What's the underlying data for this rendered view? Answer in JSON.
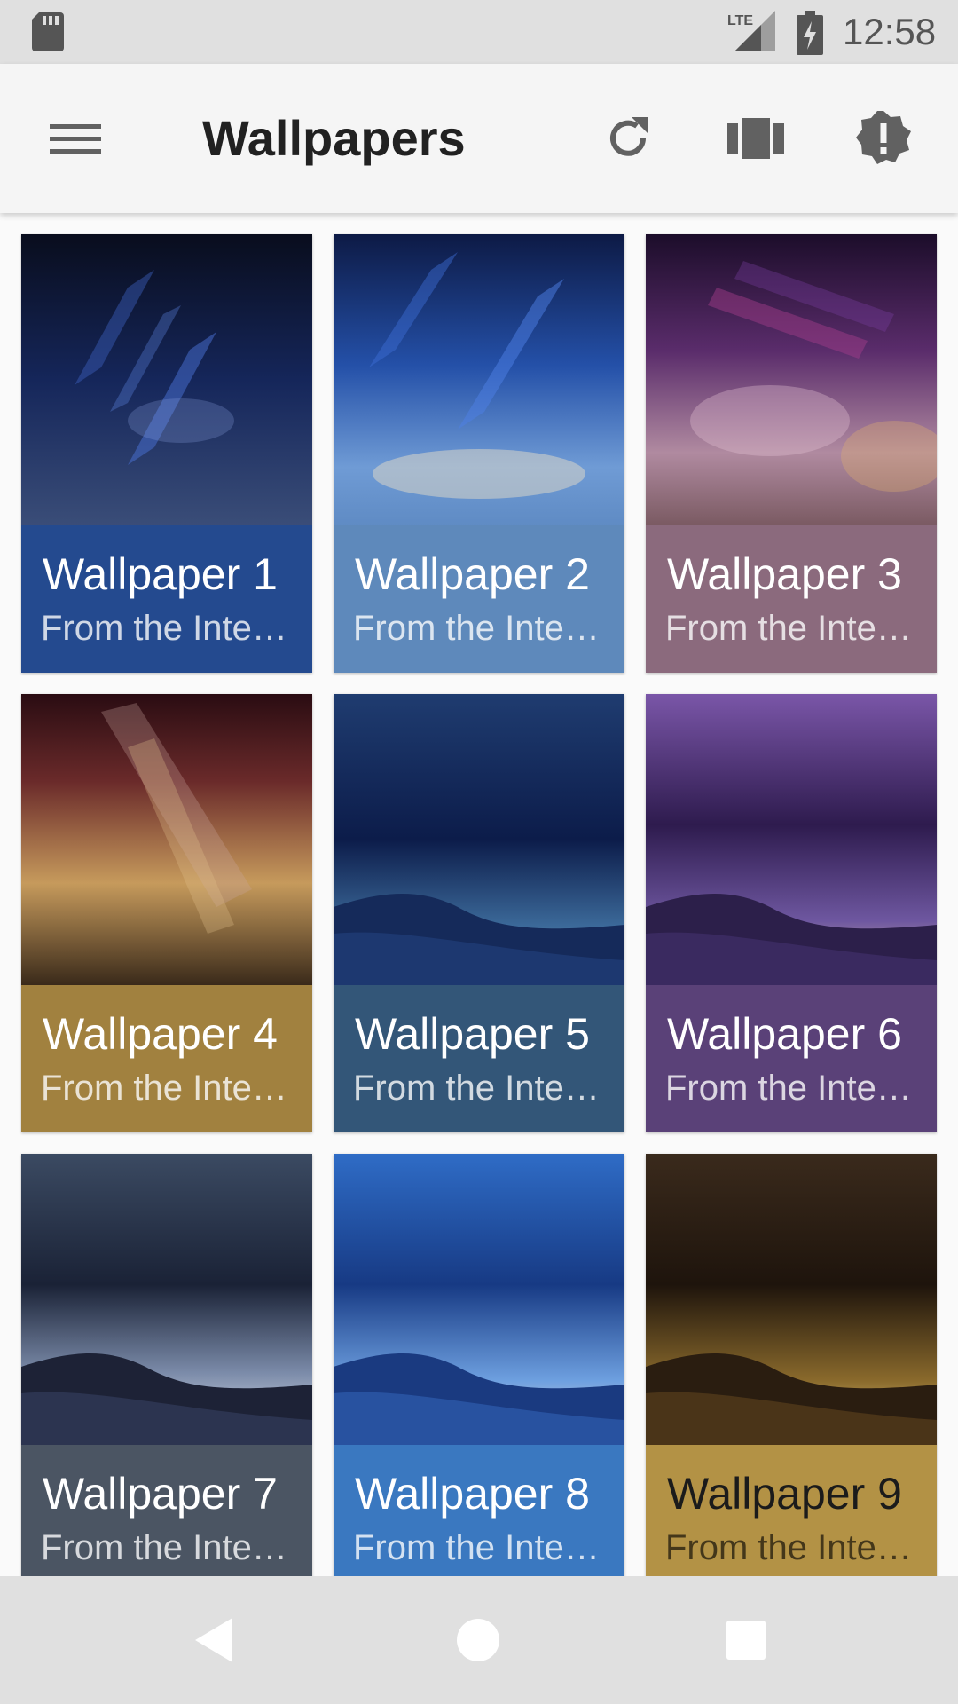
{
  "status_bar": {
    "time": "12:58",
    "network_label": "LTE",
    "icons": [
      "sd-card-icon",
      "lte-signal-icon",
      "battery-charging-icon"
    ]
  },
  "app_bar": {
    "title": "Wallpapers",
    "icons": [
      "menu-icon",
      "refresh-icon",
      "view-carousel-icon",
      "alert-badge-icon"
    ]
  },
  "wallpapers": [
    {
      "name": "Wallpaper 1",
      "source": "From the Internet",
      "caption_color": "#244a8f"
    },
    {
      "name": "Wallpaper 2",
      "source": "From the Internet",
      "caption_color": "#5e89bb"
    },
    {
      "name": "Wallpaper 3",
      "source": "From the Internet",
      "caption_color": "#8b6a7d"
    },
    {
      "name": "Wallpaper 4",
      "source": "From the Internet",
      "caption_color": "#a1813f"
    },
    {
      "name": "Wallpaper 5",
      "source": "From the Internet",
      "caption_color": "#335678"
    },
    {
      "name": "Wallpaper 6",
      "source": "From the Internet",
      "caption_color": "#5a4178"
    },
    {
      "name": "Wallpaper 7",
      "source": "From the Internet",
      "caption_color": "#4b5563"
    },
    {
      "name": "Wallpaper 8",
      "source": "From the Internet",
      "caption_color": "#3a78c0"
    },
    {
      "name": "Wallpaper 9",
      "source": "From the Internet",
      "caption_color": "#b39245"
    }
  ],
  "nav_bar": {
    "icons": [
      "back-icon",
      "home-icon",
      "recents-icon"
    ]
  }
}
